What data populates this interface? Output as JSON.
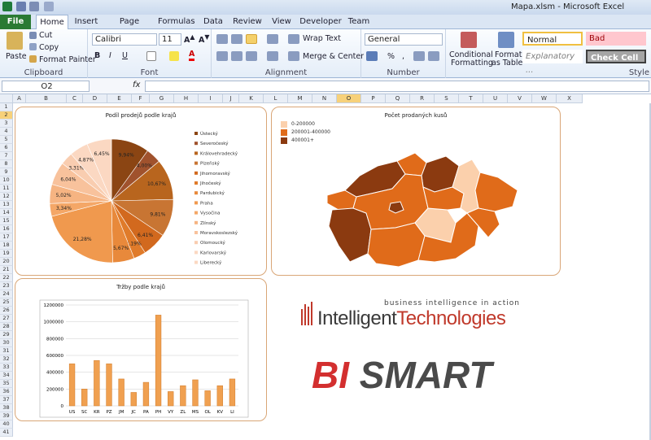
{
  "window": {
    "title": "Mapa.xlsm - Microsoft Excel"
  },
  "tabs": [
    {
      "label": "File"
    },
    {
      "label": "Home"
    },
    {
      "label": "Insert"
    },
    {
      "label": "Page Layout"
    },
    {
      "label": "Formulas"
    },
    {
      "label": "Data"
    },
    {
      "label": "Review"
    },
    {
      "label": "View"
    },
    {
      "label": "Developer"
    },
    {
      "label": "Team"
    }
  ],
  "ribbon": {
    "clipboard": {
      "paste": "Paste",
      "cut": "Cut",
      "copy": "Copy",
      "format_painter": "Format Painter",
      "label": "Clipboard"
    },
    "font": {
      "name": "Calibri",
      "size": "11",
      "label": "Font"
    },
    "alignment": {
      "wrap": "Wrap Text",
      "merge": "Merge & Center",
      "label": "Alignment"
    },
    "number": {
      "format": "General",
      "label": "Number"
    },
    "styles": {
      "conditional": "Conditional",
      "conditional2": "Formatting",
      "format_as": "Format",
      "format_as2": "as Table",
      "normal": "Normal",
      "bad": "Bad",
      "explanatory": "Explanatory ...",
      "check": "Check Cell",
      "label": "Style"
    }
  },
  "formula": {
    "namebox": "O2",
    "fx": "fx"
  },
  "columns": [
    "A",
    "B",
    "C",
    "D",
    "E",
    "F",
    "G",
    "H",
    "I",
    "J",
    "K",
    "L",
    "M",
    "N",
    "O",
    "P",
    "Q",
    "R",
    "S",
    "T",
    "U",
    "V",
    "W",
    "X"
  ],
  "rows": [
    "1",
    "2",
    "3",
    "4",
    "5",
    "6",
    "7",
    "8",
    "9",
    "10",
    "11",
    "12",
    "13",
    "14",
    "15",
    "16",
    "17",
    "18",
    "19",
    "20",
    "21",
    "22",
    "23",
    "24",
    "25",
    "26",
    "27",
    "28",
    "29",
    "30",
    "31",
    "32",
    "33",
    "34",
    "35",
    "36",
    "37",
    "38",
    "39",
    "40",
    "41"
  ],
  "selected": {
    "column": "O",
    "row": "2"
  },
  "colors": {
    "c1": "#8b4513",
    "c2": "#a0522d",
    "c3": "#b8651e",
    "c4": "#c87533",
    "c5": "#d2691e",
    "c6": "#e07b2a",
    "c7": "#e8893b",
    "c8": "#f0994e",
    "c9": "#f4a767",
    "c10": "#f6b482",
    "c11": "#f8c29c",
    "c12": "#f9cdb0",
    "c13": "#fbd8c2",
    "map_low": "#fbd0ac",
    "map_mid": "#e06b1a",
    "map_high": "#8b3a10"
  },
  "chart_data": [
    {
      "type": "pie",
      "title": "Podíl prodejů podle krajů",
      "categories": [
        "Ústecký",
        "Severočeský",
        "Královehradecký",
        "Plzeňský",
        "Jihomoravský",
        "Jihočeský",
        "Pardubický",
        "Praha",
        "Vysočina",
        "Zlínský",
        "Moravskoslezský",
        "Olomoucký",
        "Karlovarský",
        "Liberecký"
      ],
      "slice_labels": [
        "9,94%",
        "4,00%",
        "10,67%",
        "9,81%",
        "6,41%",
        "3,19%",
        "5,67%",
        "21,28%",
        "3,34%",
        "5,02%",
        "6,04%",
        "3,31%",
        "4,87%",
        "6,45%"
      ],
      "values": [
        9.94,
        4.0,
        10.67,
        9.81,
        6.41,
        3.19,
        5.67,
        21.28,
        3.34,
        5.02,
        6.04,
        3.31,
        4.87,
        6.45
      ]
    },
    {
      "type": "map",
      "title": "Počet prodaných kusů",
      "legend": [
        "0-200000",
        "200001-400000",
        "400001+"
      ]
    },
    {
      "type": "bar",
      "title": "Tržby podle krajů",
      "categories": [
        "US",
        "SC",
        "KR",
        "PZ",
        "JM",
        "JC",
        "PA",
        "PH",
        "VY",
        "ZL",
        "MS",
        "OL",
        "KV",
        "LI"
      ],
      "values": [
        500000,
        200000,
        540000,
        500000,
        320000,
        160000,
        280000,
        1080000,
        170000,
        240000,
        310000,
        180000,
        240000,
        320000
      ],
      "yticks": [
        "1200000",
        "1000000",
        "800000",
        "600000",
        "400000",
        "200000",
        "0"
      ],
      "ylim": [
        0,
        1200000
      ]
    }
  ],
  "logos": {
    "it_tag": "business intelligence in action",
    "it_name1": "Intelligent",
    "it_name2": "Technologies",
    "bi": "BI",
    "smart": "SMART"
  }
}
